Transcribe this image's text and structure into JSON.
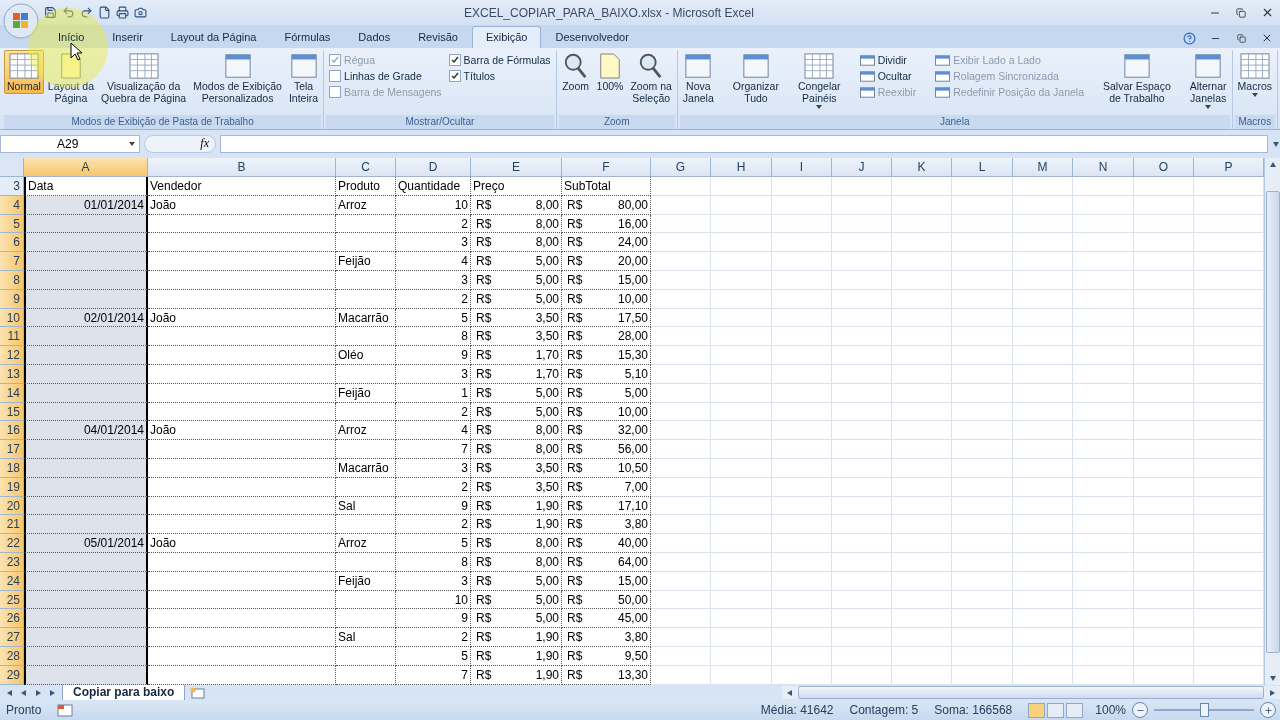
{
  "window": {
    "title": "EXCEL_COPIAR_PARA_BAIXO.xlsx - Microsoft Excel"
  },
  "tabs": [
    {
      "label": "Início",
      "selected": false
    },
    {
      "label": "Inserir",
      "selected": false
    },
    {
      "label": "Layout da Página",
      "selected": false
    },
    {
      "label": "Fórmulas",
      "selected": false
    },
    {
      "label": "Dados",
      "selected": false
    },
    {
      "label": "Revisão",
      "selected": false
    },
    {
      "label": "Exibição",
      "selected": true
    },
    {
      "label": "Desenvolvedor",
      "selected": false
    }
  ],
  "ribbon": {
    "groups": [
      {
        "label": "Modos de Exibição de Pasta de Trabalho",
        "items": [
          {
            "kind": "large",
            "label": "Normal",
            "selected": true
          },
          {
            "kind": "large",
            "label": "Layout da\nPágina",
            "selected": false
          },
          {
            "kind": "large",
            "label": "Visualização da\nQuebra de Página",
            "selected": false
          },
          {
            "kind": "large",
            "label": "Modos de Exibição\nPersonalizados",
            "selected": false
          },
          {
            "kind": "large",
            "label": "Tela\nInteira",
            "selected": false
          }
        ]
      },
      {
        "label": "Mostrar/Ocultar",
        "items": [
          {
            "kind": "stack",
            "items": [
              {
                "kind": "check",
                "label": "Régua",
                "checked": true,
                "disabled": true
              },
              {
                "kind": "check",
                "label": "Linhas de Grade",
                "checked": false,
                "disabled": false
              },
              {
                "kind": "check",
                "label": "Barra de Mensagens",
                "checked": false,
                "disabled": true
              }
            ]
          },
          {
            "kind": "stack",
            "items": [
              {
                "kind": "check",
                "label": "Barra de Fórmulas",
                "checked": true,
                "disabled": false
              },
              {
                "kind": "check",
                "label": "Títulos",
                "checked": true,
                "disabled": false
              }
            ]
          }
        ]
      },
      {
        "label": "Zoom",
        "items": [
          {
            "kind": "large",
            "label": "Zoom",
            "selected": false
          },
          {
            "kind": "large",
            "label": "100%",
            "selected": false
          },
          {
            "kind": "large",
            "label": "Zoom na\nSeleção",
            "selected": false
          }
        ]
      },
      {
        "label": "Janela",
        "items": [
          {
            "kind": "large",
            "label": "Nova\nJanela",
            "selected": false
          },
          {
            "kind": "large",
            "label": "Organizar\nTudo",
            "selected": false
          },
          {
            "kind": "large",
            "label": "Congelar\nPainéis",
            "selected": false,
            "dropdown": true
          },
          {
            "kind": "stack",
            "items": [
              {
                "kind": "small",
                "label": "Dividir",
                "disabled": false
              },
              {
                "kind": "small",
                "label": "Ocultar",
                "disabled": false
              },
              {
                "kind": "small",
                "label": "Reexibir",
                "disabled": true
              }
            ]
          },
          {
            "kind": "stack",
            "items": [
              {
                "kind": "small",
                "label": "Exibir Lado a Lado",
                "disabled": true
              },
              {
                "kind": "small",
                "label": "Rolagem Sincronizada",
                "disabled": true
              },
              {
                "kind": "small",
                "label": "Redefinir Posição da Janela",
                "disabled": true
              }
            ]
          },
          {
            "kind": "large",
            "label": "Salvar Espaço\nde Trabalho",
            "selected": false
          },
          {
            "kind": "large",
            "label": "Alternar\nJanelas",
            "selected": false,
            "dropdown": true
          }
        ]
      },
      {
        "label": "Macros",
        "items": [
          {
            "kind": "large",
            "label": "Macros",
            "selected": false,
            "dropdown": true
          }
        ]
      }
    ]
  },
  "formula_bar": {
    "name_box": "A29",
    "fx": "fx"
  },
  "sheet": {
    "columns": [
      {
        "label": "A",
        "selected": true
      },
      {
        "label": "B",
        "selected": false
      },
      {
        "label": "C",
        "selected": false
      },
      {
        "label": "D",
        "selected": false
      },
      {
        "label": "E",
        "selected": false
      },
      {
        "label": "F",
        "selected": false
      },
      {
        "label": "G",
        "selected": false
      },
      {
        "label": "H",
        "selected": false
      },
      {
        "label": "I",
        "selected": false
      },
      {
        "label": "J",
        "selected": false
      },
      {
        "label": "K",
        "selected": false
      },
      {
        "label": "L",
        "selected": false
      },
      {
        "label": "M",
        "selected": false
      },
      {
        "label": "N",
        "selected": false
      },
      {
        "label": "O",
        "selected": false
      },
      {
        "label": "P",
        "selected": false
      }
    ],
    "header_row": {
      "row": "3",
      "cells": [
        "Data",
        "Vendedor",
        "Produto",
        "Quantidade",
        "Preço",
        "SubTotal"
      ]
    },
    "rows": [
      {
        "row": "4",
        "selected": true,
        "data": "01/01/2014",
        "vendedor": "João",
        "produto": "Arroz",
        "quantidade": "10",
        "moeda_preco": "R$",
        "preco": "8,00",
        "moeda_subtotal": "R$",
        "subtotal": "80,00"
      },
      {
        "row": "5",
        "selected": true,
        "quantidade": "2",
        "moeda_preco": "R$",
        "preco": "8,00",
        "moeda_subtotal": "R$",
        "subtotal": "16,00"
      },
      {
        "row": "6",
        "selected": true,
        "quantidade": "3",
        "moeda_preco": "R$",
        "preco": "8,00",
        "moeda_subtotal": "R$",
        "subtotal": "24,00"
      },
      {
        "row": "7",
        "selected": true,
        "produto": "Feijão",
        "quantidade": "4",
        "moeda_preco": "R$",
        "preco": "5,00",
        "moeda_subtotal": "R$",
        "subtotal": "20,00"
      },
      {
        "row": "8",
        "selected": true,
        "quantidade": "3",
        "moeda_preco": "R$",
        "preco": "5,00",
        "moeda_subtotal": "R$",
        "subtotal": "15,00"
      },
      {
        "row": "9",
        "selected": true,
        "quantidade": "2",
        "moeda_preco": "R$",
        "preco": "5,00",
        "moeda_subtotal": "R$",
        "subtotal": "10,00"
      },
      {
        "row": "10",
        "selected": true,
        "data": "02/01/2014",
        "vendedor": "João",
        "produto": "Macarrão",
        "quantidade": "5",
        "moeda_preco": "R$",
        "preco": "3,50",
        "moeda_subtotal": "R$",
        "subtotal": "17,50"
      },
      {
        "row": "11",
        "selected": true,
        "quantidade": "8",
        "moeda_preco": "R$",
        "preco": "3,50",
        "moeda_subtotal": "R$",
        "subtotal": "28,00"
      },
      {
        "row": "12",
        "selected": true,
        "produto": "Oléo",
        "quantidade": "9",
        "moeda_preco": "R$",
        "preco": "1,70",
        "moeda_subtotal": "R$",
        "subtotal": "15,30"
      },
      {
        "row": "13",
        "selected": true,
        "quantidade": "3",
        "moeda_preco": "R$",
        "preco": "1,70",
        "moeda_subtotal": "R$",
        "subtotal": "5,10"
      },
      {
        "row": "14",
        "selected": true,
        "produto": "Feijão",
        "quantidade": "1",
        "moeda_preco": "R$",
        "preco": "5,00",
        "moeda_subtotal": "R$",
        "subtotal": "5,00"
      },
      {
        "row": "15",
        "selected": true,
        "quantidade": "2",
        "moeda_preco": "R$",
        "preco": "5,00",
        "moeda_subtotal": "R$",
        "subtotal": "10,00"
      },
      {
        "row": "16",
        "selected": true,
        "data": "04/01/2014",
        "vendedor": "João",
        "produto": "Arroz",
        "quantidade": "4",
        "moeda_preco": "R$",
        "preco": "8,00",
        "moeda_subtotal": "R$",
        "subtotal": "32,00"
      },
      {
        "row": "17",
        "selected": true,
        "quantidade": "7",
        "moeda_preco": "R$",
        "preco": "8,00",
        "moeda_subtotal": "R$",
        "subtotal": "56,00"
      },
      {
        "row": "18",
        "selected": true,
        "produto": "Macarrão",
        "quantidade": "3",
        "moeda_preco": "R$",
        "preco": "3,50",
        "moeda_subtotal": "R$",
        "subtotal": "10,50"
      },
      {
        "row": "19",
        "selected": true,
        "quantidade": "2",
        "moeda_preco": "R$",
        "preco": "3,50",
        "moeda_subtotal": "R$",
        "subtotal": "7,00"
      },
      {
        "row": "20",
        "selected": true,
        "produto": "Sal",
        "quantidade": "9",
        "moeda_preco": "R$",
        "preco": "1,90",
        "moeda_subtotal": "R$",
        "subtotal": "17,10"
      },
      {
        "row": "21",
        "selected": true,
        "quantidade": "2",
        "moeda_preco": "R$",
        "preco": "1,90",
        "moeda_subtotal": "R$",
        "subtotal": "3,80"
      },
      {
        "row": "22",
        "selected": true,
        "data": "05/01/2014",
        "vendedor": "João",
        "produto": "Arroz",
        "quantidade": "5",
        "moeda_preco": "R$",
        "preco": "8,00",
        "moeda_subtotal": "R$",
        "subtotal": "40,00"
      },
      {
        "row": "23",
        "selected": true,
        "quantidade": "8",
        "moeda_preco": "R$",
        "preco": "8,00",
        "moeda_subtotal": "R$",
        "subtotal": "64,00"
      },
      {
        "row": "24",
        "selected": true,
        "produto": "Feijão",
        "quantidade": "3",
        "moeda_preco": "R$",
        "preco": "5,00",
        "moeda_subtotal": "R$",
        "subtotal": "15,00"
      },
      {
        "row": "25",
        "selected": true,
        "quantidade": "10",
        "moeda_preco": "R$",
        "preco": "5,00",
        "moeda_subtotal": "R$",
        "subtotal": "50,00"
      },
      {
        "row": "26",
        "selected": true,
        "quantidade": "9",
        "moeda_preco": "R$",
        "preco": "5,00",
        "moeda_subtotal": "R$",
        "subtotal": "45,00"
      },
      {
        "row": "27",
        "selected": true,
        "produto": "Sal",
        "quantidade": "2",
        "moeda_preco": "R$",
        "preco": "1,90",
        "moeda_subtotal": "R$",
        "subtotal": "3,80"
      },
      {
        "row": "28",
        "selected": true,
        "quantidade": "5",
        "moeda_preco": "R$",
        "preco": "1,90",
        "moeda_subtotal": "R$",
        "subtotal": "9,50"
      },
      {
        "row": "29",
        "selected": true,
        "quantidade": "7",
        "moeda_preco": "R$",
        "preco": "1,90",
        "moeda_subtotal": "R$",
        "subtotal": "13,30"
      }
    ]
  },
  "sheet_tabs": [
    {
      "label": "Copiar para baixo",
      "selected": true
    }
  ],
  "status_bar": {
    "status": "Pronto",
    "stats": [
      "Média: 41642",
      "Contagem: 5",
      "Soma: 166568"
    ],
    "views": [
      {
        "selected": true
      },
      {
        "selected": false
      },
      {
        "selected": false
      }
    ],
    "zoom": "100%",
    "zoom_slider": {
      "level": 0.5
    }
  }
}
